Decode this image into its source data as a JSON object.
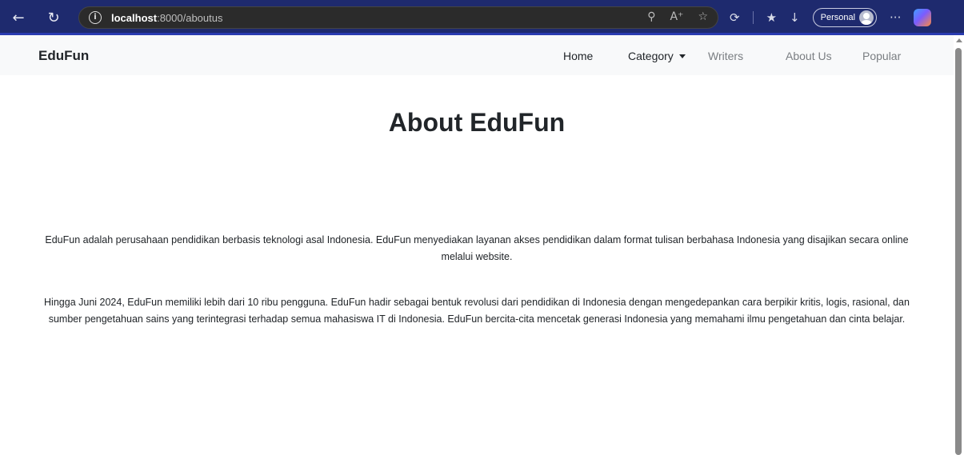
{
  "browser": {
    "url_host": "localhost",
    "url_path": ":8000/aboutus",
    "profile_label": "Personal",
    "icons": [
      "back-arrow-icon",
      "reload-icon",
      "site-info-icon",
      "zoom-icon",
      "read-aloud-icon",
      "favorite-star-icon",
      "extensions-icon",
      "favorites-icon",
      "download-icon",
      "more-icon",
      "copilot-icon"
    ]
  },
  "navbar": {
    "brand": "EduFun",
    "items": [
      {
        "label": "Home",
        "active": true
      },
      {
        "label": "Category",
        "dropdown": true
      },
      {
        "label": "Writers"
      },
      {
        "label": "About Us"
      },
      {
        "label": "Popular"
      }
    ]
  },
  "main": {
    "title": "About EduFun",
    "paragraphs": [
      "EduFun adalah perusahaan pendidikan berbasis teknologi asal Indonesia. EduFun menyediakan layanan akses pendidikan dalam format tulisan berbahasa Indonesia yang disajikan secara online melalui website.",
      "Hingga Juni 2024, EduFun memiliki lebih dari 10 ribu pengguna. EduFun hadir sebagai bentuk revolusi dari pendidikan di Indonesia dengan mengedepankan cara berpikir kritis, logis, rasional, dan sumber pengetahuan sains yang terintegrasi terhadap semua mahasiswa IT di Indonesia. EduFun bercita-cita mencetak generasi Indonesia yang memahami ilmu pengetahuan dan cinta belajar."
    ]
  },
  "colors": {
    "chrome_bg": "#1e2a6e",
    "navbar_bg": "#f8f9fa",
    "text": "#212529",
    "nav_muted": "#7a7e82"
  }
}
